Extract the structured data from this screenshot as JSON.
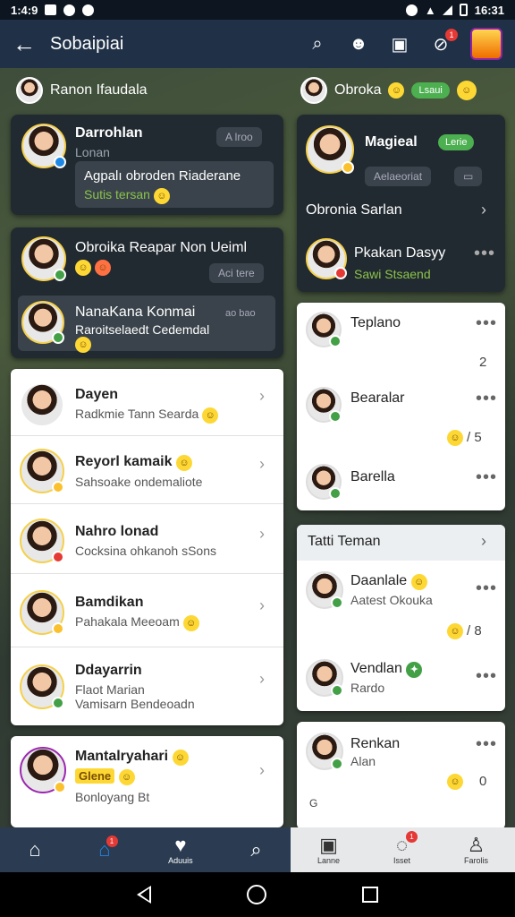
{
  "status": {
    "time_left": "1:4:9",
    "time_right": "16:31"
  },
  "appbar": {
    "title": "Sobaipiai",
    "notif_badge": "1"
  },
  "strip_left": {
    "name": "Ranon Ifaudala"
  },
  "strip_right": {
    "name": "Obroka",
    "pill": "Lsaui"
  },
  "left_cards": {
    "c1": {
      "name": "Darrohlan",
      "sub": "Lonan",
      "chip": "A lroo",
      "msg": "Agpalı obroden Riaderane",
      "status": "Sutis tersan"
    },
    "c2": {
      "name": "Obroika Reapar Non Ueiml",
      "chip": "Aci tere"
    },
    "c3": {
      "name": "NanaKana Konmai",
      "chip": "ao bao",
      "sub": "Raroitselaedt Cedemdal"
    }
  },
  "right_top": {
    "r1": {
      "name": "Magieal",
      "pill": "Lerie",
      "chip": "Aelaeoriat"
    },
    "r2": {
      "name": "Obronia Sarlan"
    },
    "r3": {
      "name": "Pkakan Dasyy",
      "status": "Sawi Stsaend"
    }
  },
  "friends_list": [
    {
      "name": "Dayen",
      "sub": "Radkmie Tann Searda"
    },
    {
      "name": "Reyorl kamaik",
      "sub": "Sahsoake ondemaliote"
    },
    {
      "name": "Nahro lonad",
      "sub": "Cocksina ohkanoh sSons"
    },
    {
      "name": "Bamdikan",
      "sub": "Pahakala Meeoam"
    },
    {
      "name": "Ddayarrin",
      "sub": "Flaot Marian",
      "sub2": "Vamisarn Bendeoadn"
    },
    {
      "name": "Mantalryahari",
      "tag": "Glene",
      "sub": "Bonloyang Bt"
    }
  ],
  "right_mid": [
    {
      "name": "Teplano",
      "num": "2"
    },
    {
      "name": "Bearalar",
      "num": "/ 5"
    },
    {
      "name": "Barella"
    }
  ],
  "tati_teman": {
    "header": "Tatti Teman",
    "items": [
      {
        "name": "Daanlale",
        "sub": "Aatest Okouka",
        "num": "/ 8"
      },
      {
        "name": "Vendlan",
        "sub": "Rardo"
      }
    ]
  },
  "last_card": {
    "name": "Renkan",
    "sub": "Alan",
    "num": "0",
    "letter": "G"
  },
  "bottom_nav": {
    "left": [
      {
        "label": ""
      },
      {
        "label": ""
      },
      {
        "label": "Aduuis"
      },
      {
        "label": ""
      }
    ],
    "right": [
      {
        "label": "Lanne"
      },
      {
        "label": "Isset"
      },
      {
        "label": "Farolis"
      }
    ],
    "badge": "1"
  }
}
